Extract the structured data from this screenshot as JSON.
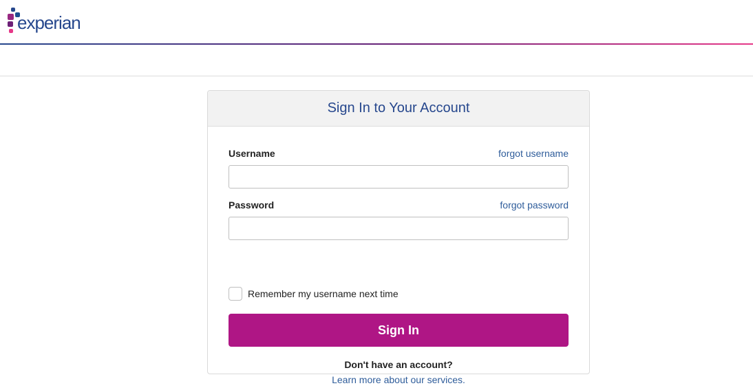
{
  "brand": {
    "name": "experian",
    "colors": {
      "primary": "#26478d",
      "accent": "#af1685",
      "pink": "#e63888",
      "link": "#2e5c9a"
    }
  },
  "signin_card": {
    "title": "Sign In to Your Account",
    "username": {
      "label": "Username",
      "forgot_link": "forgot username",
      "value": "",
      "placeholder": ""
    },
    "password": {
      "label": "Password",
      "forgot_link": "forgot password",
      "value": "",
      "placeholder": ""
    },
    "remember": {
      "label": "Remember my username next time",
      "checked": false
    },
    "submit_label": "Sign In",
    "no_account_text": "Don't have an account?",
    "learn_more_link": "Learn more about our services."
  }
}
